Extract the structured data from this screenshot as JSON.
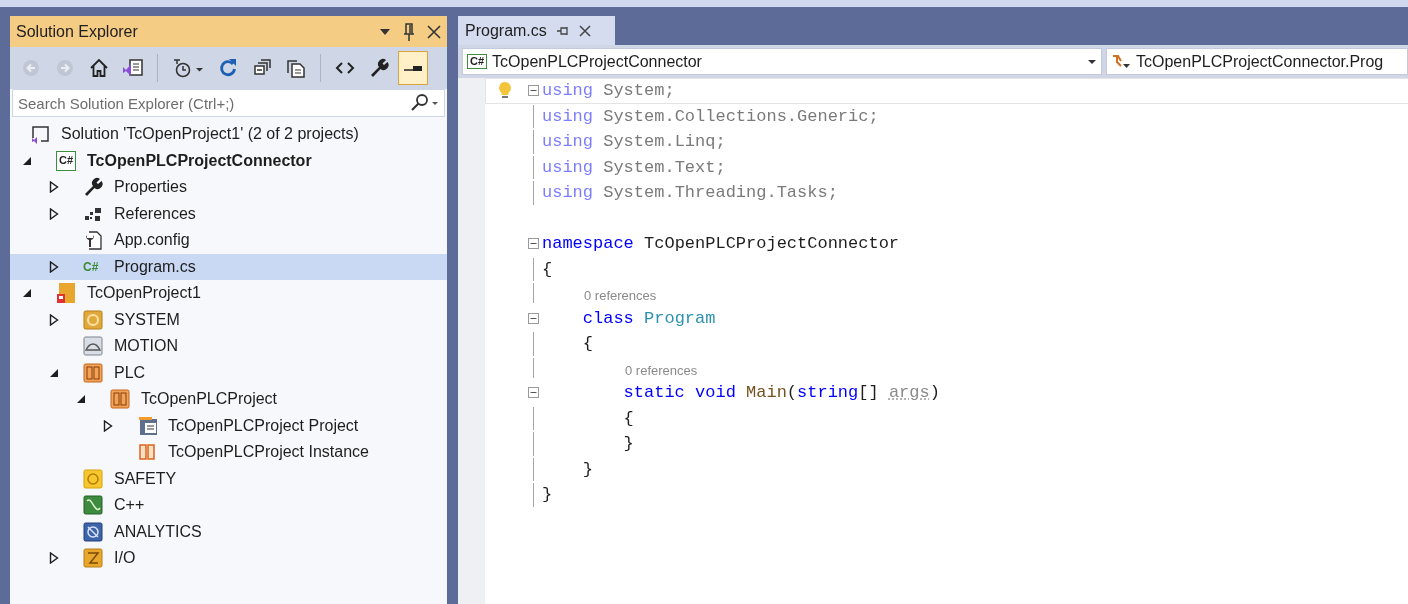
{
  "solution_explorer": {
    "title": "Solution Explorer",
    "toolbar": [
      {
        "kind": "back",
        "disabled": true,
        "pressed": false
      },
      {
        "kind": "forward",
        "disabled": true,
        "pressed": false
      },
      {
        "kind": "home",
        "disabled": false,
        "pressed": false
      },
      {
        "kind": "switch-views",
        "disabled": false,
        "pressed": false
      },
      {
        "kind": "separator"
      },
      {
        "kind": "pending-changes",
        "disabled": false,
        "pressed": false
      },
      {
        "kind": "refresh",
        "disabled": false,
        "pressed": false
      },
      {
        "kind": "collapse-all",
        "disabled": false,
        "pressed": false
      },
      {
        "kind": "show-all-files",
        "disabled": false,
        "pressed": false
      },
      {
        "kind": "separator"
      },
      {
        "kind": "view-code",
        "disabled": false,
        "pressed": false
      },
      {
        "kind": "properties",
        "disabled": false,
        "pressed": false
      },
      {
        "kind": "preview",
        "disabled": false,
        "pressed": true
      }
    ],
    "search": {
      "placeholder": "Search Solution Explorer (Ctrl+;)"
    },
    "tree": [
      {
        "label": "Solution 'TcOpenProject1' (2 of 2 projects)",
        "kind": "solution",
        "selected": false,
        "startup": false,
        "children": [
          {
            "label": "TcOpenPLCProjectConnector",
            "kind": "csharp-project",
            "icon_label": "C#",
            "selected": false,
            "startup": true,
            "expanded": true,
            "children": [
              {
                "label": "Properties",
                "kind": "wrench",
                "selected": false,
                "startup": false,
                "expanded": false
              },
              {
                "label": "References",
                "kind": "references",
                "selected": false,
                "startup": false,
                "expanded": false
              },
              {
                "label": "App.config",
                "kind": "config",
                "selected": false,
                "startup": false
              },
              {
                "label": "Program.cs",
                "kind": "csharp-file",
                "icon_label": "C#",
                "selected": true,
                "startup": false,
                "expanded": false
              }
            ]
          },
          {
            "label": "TcOpenProject1",
            "kind": "twincat-project",
            "selected": false,
            "startup": false,
            "expanded": true,
            "children": [
              {
                "label": "SYSTEM",
                "kind": "system",
                "selected": false,
                "startup": false,
                "expanded": false
              },
              {
                "label": "MOTION",
                "kind": "motion",
                "selected": false,
                "startup": false
              },
              {
                "label": "PLC",
                "kind": "plc",
                "selected": false,
                "startup": false,
                "expanded": true,
                "children": [
                  {
                    "label": "TcOpenPLCProject",
                    "kind": "plc",
                    "selected": false,
                    "startup": false,
                    "expanded": true,
                    "children": [
                      {
                        "label": "TcOpenPLCProject Project",
                        "kind": "plc-code",
                        "selected": false,
                        "startup": false,
                        "expanded": false
                      },
                      {
                        "label": "TcOpenPLCProject Instance",
                        "kind": "plc-instance",
                        "selected": false,
                        "startup": false
                      }
                    ]
                  }
                ]
              },
              {
                "label": "SAFETY",
                "kind": "safety",
                "selected": false,
                "startup": false
              },
              {
                "label": "C++",
                "kind": "cpp",
                "selected": false,
                "startup": false
              },
              {
                "label": "ANALYTICS",
                "kind": "analytics",
                "selected": false,
                "startup": false
              },
              {
                "label": "I/O",
                "kind": "io",
                "selected": false,
                "startup": false,
                "expanded": false
              }
            ]
          }
        ]
      }
    ]
  },
  "editor": {
    "tabs": [
      {
        "label": "Program.cs",
        "selected": true
      }
    ],
    "nav_bar": {
      "project": {
        "icon_label": "C#",
        "text": "TcOpenPLCProjectConnector"
      },
      "member": {
        "text": "TcOpenPLCProjectConnector.Prog"
      }
    },
    "lines": [
      {
        "kind": "code",
        "current": true,
        "fold_expanded": true,
        "tokens": [
          {
            "text": "using",
            "kind": "keyword-faded"
          },
          {
            "text": " System;",
            "kind": "faded"
          }
        ]
      },
      {
        "kind": "code",
        "current": false,
        "tokens": [
          {
            "text": "using",
            "kind": "keyword-faded"
          },
          {
            "text": " System.Collections.Generic;",
            "kind": "faded"
          }
        ]
      },
      {
        "kind": "code",
        "current": false,
        "tokens": [
          {
            "text": "using",
            "kind": "keyword-faded"
          },
          {
            "text": " System.Linq;",
            "kind": "faded"
          }
        ]
      },
      {
        "kind": "code",
        "current": false,
        "tokens": [
          {
            "text": "using",
            "kind": "keyword-faded"
          },
          {
            "text": " System.Text;",
            "kind": "faded"
          }
        ]
      },
      {
        "kind": "code",
        "current": false,
        "tokens": [
          {
            "text": "using",
            "kind": "keyword-faded"
          },
          {
            "text": " System.Threading.Tasks;",
            "kind": "faded"
          }
        ]
      },
      {
        "kind": "blank",
        "current": false
      },
      {
        "kind": "code",
        "current": false,
        "fold_expanded": true,
        "tokens": [
          {
            "text": "namespace",
            "kind": "keyword"
          },
          {
            "text": " TcOpenPLCProjectConnector",
            "kind": "plain"
          }
        ]
      },
      {
        "kind": "code",
        "current": false,
        "tokens": [
          {
            "text": "{",
            "kind": "plain"
          }
        ]
      },
      {
        "kind": "lens",
        "current": false,
        "text": "0 references"
      },
      {
        "kind": "code",
        "current": false,
        "fold_expanded": true,
        "tokens": [
          {
            "text": "    class",
            "kind": "keyword"
          },
          {
            "text": " Program",
            "kind": "type"
          }
        ]
      },
      {
        "kind": "code",
        "current": false,
        "tokens": [
          {
            "text": "    {",
            "kind": "plain"
          }
        ]
      },
      {
        "kind": "lens",
        "current": false,
        "text": "0 references"
      },
      {
        "kind": "code",
        "current": false,
        "fold_expanded": true,
        "tokens": [
          {
            "text": "        static void",
            "kind": "keyword"
          },
          {
            "text": " Main",
            "kind": "method"
          },
          {
            "text": "(",
            "kind": "plain"
          },
          {
            "text": "string",
            "kind": "keyword"
          },
          {
            "text": "[] ",
            "kind": "plain"
          },
          {
            "text": "args",
            "kind": "unused"
          },
          {
            "text": ")",
            "kind": "plain"
          }
        ]
      },
      {
        "kind": "code",
        "current": false,
        "tokens": [
          {
            "text": "        {",
            "kind": "plain"
          }
        ]
      },
      {
        "kind": "code",
        "current": false,
        "tokens": [
          {
            "text": "        }",
            "kind": "plain"
          }
        ]
      },
      {
        "kind": "code",
        "current": false,
        "tokens": [
          {
            "text": "    }",
            "kind": "plain"
          }
        ]
      },
      {
        "kind": "code",
        "current": false,
        "tokens": [
          {
            "text": "}",
            "kind": "plain"
          }
        ]
      }
    ]
  }
}
